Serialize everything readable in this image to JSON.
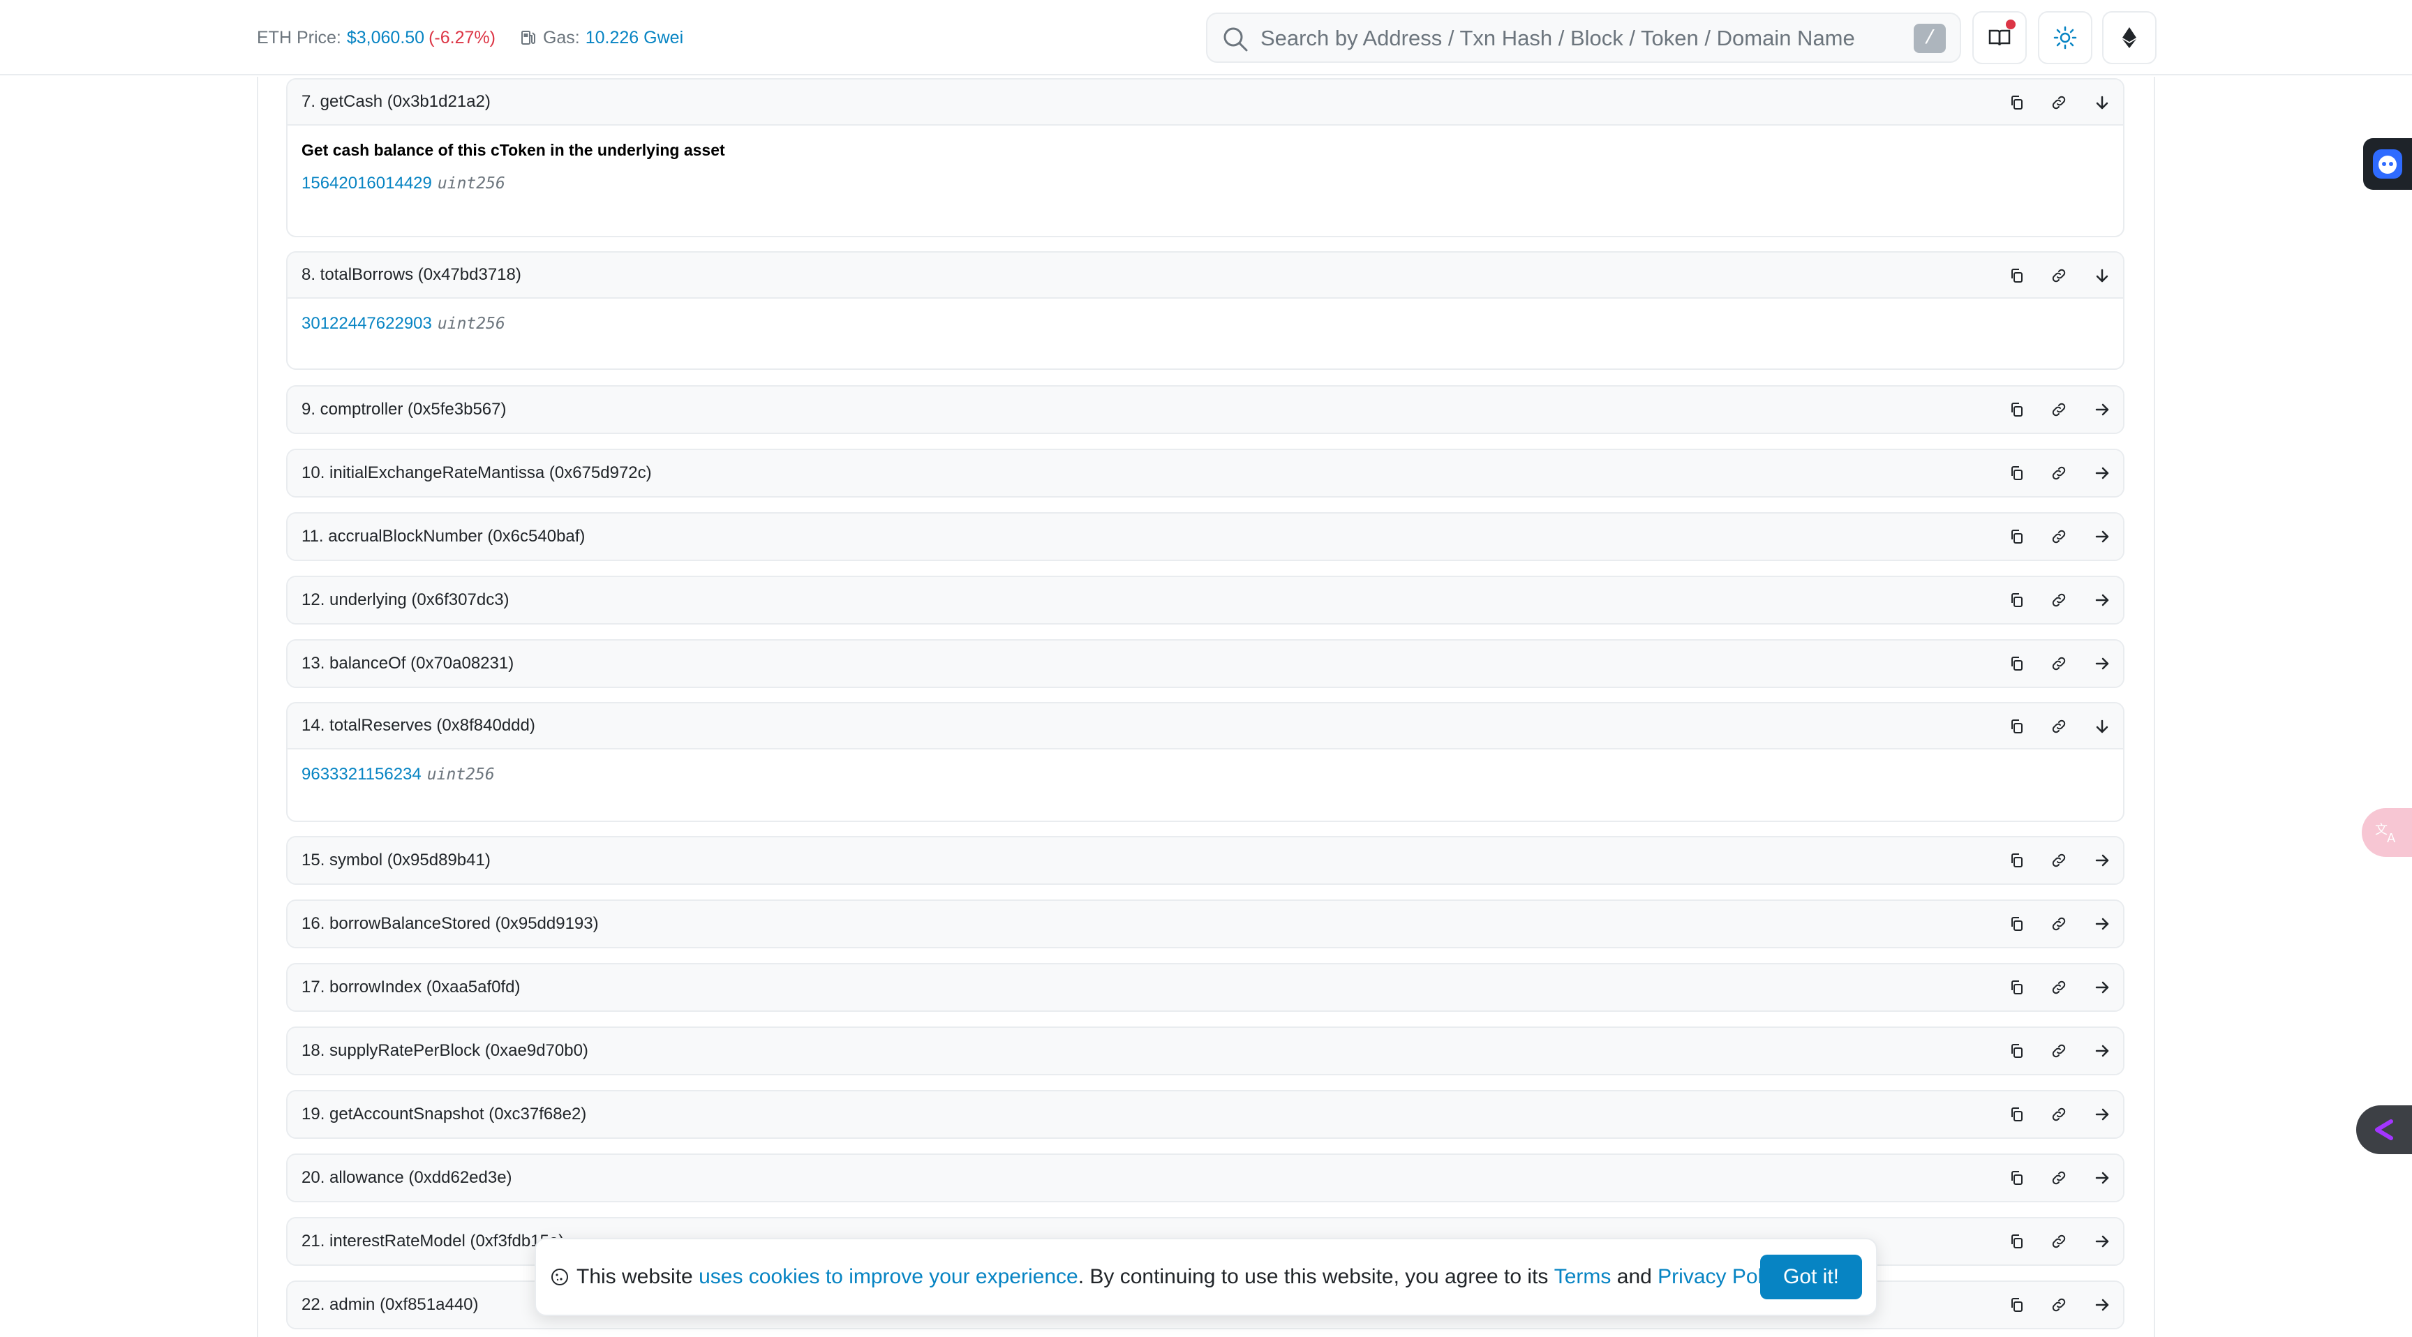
{
  "header": {
    "eth_price_label": "ETH Price:",
    "eth_price_value": "$3,060.50",
    "eth_price_change": "(-6.27%)",
    "gas_label": "Gas:",
    "gas_value": "10.226 Gwei",
    "search_placeholder": "Search by Address / Txn Hash / Block / Token / Domain Name",
    "search_shortcut": "/"
  },
  "functions": [
    {
      "label": "7. getCash (0x3b1d21a2)",
      "open": true,
      "description": "Get cash balance of this cToken in the underlying asset",
      "result": "15642016014429",
      "result_type": "uint256"
    },
    {
      "label": "8. totalBorrows (0x47bd3718)",
      "open": true,
      "result": "30122447622903",
      "result_type": "uint256"
    },
    {
      "label": "9. comptroller (0x5fe3b567)"
    },
    {
      "label": "10. initialExchangeRateMantissa (0x675d972c)"
    },
    {
      "label": "11. accrualBlockNumber (0x6c540baf)"
    },
    {
      "label": "12. underlying (0x6f307dc3)"
    },
    {
      "label": "13. balanceOf (0x70a08231)"
    },
    {
      "label": "14. totalReserves (0x8f840ddd)",
      "open": true,
      "result": "9633321156234",
      "result_type": "uint256"
    },
    {
      "label": "15. symbol (0x95d89b41)"
    },
    {
      "label": "16. borrowBalanceStored (0x95dd9193)"
    },
    {
      "label": "17. borrowIndex (0xaa5af0fd)"
    },
    {
      "label": "18. supplyRatePerBlock (0xae9d70b0)"
    },
    {
      "label": "19. getAccountSnapshot (0xc37f68e2)"
    },
    {
      "label": "20. allowance (0xdd62ed3e)"
    },
    {
      "label": "21. interestRateModel (0xf3fdb15a)"
    },
    {
      "label": "22. admin (0xf851a440)"
    }
  ],
  "cookie": {
    "text_1": "This website",
    "link_1": "uses cookies to improve your experience",
    "text_2": ". By continuing to use this website, you agree to its",
    "link_terms": "Terms",
    "text_and": "and",
    "link_privacy": "Privacy Policy",
    "text_end": ".",
    "button": "Got it!"
  },
  "colors": {
    "link": "#0784c3",
    "negative": "#dc3545",
    "border": "#e9ecef"
  }
}
